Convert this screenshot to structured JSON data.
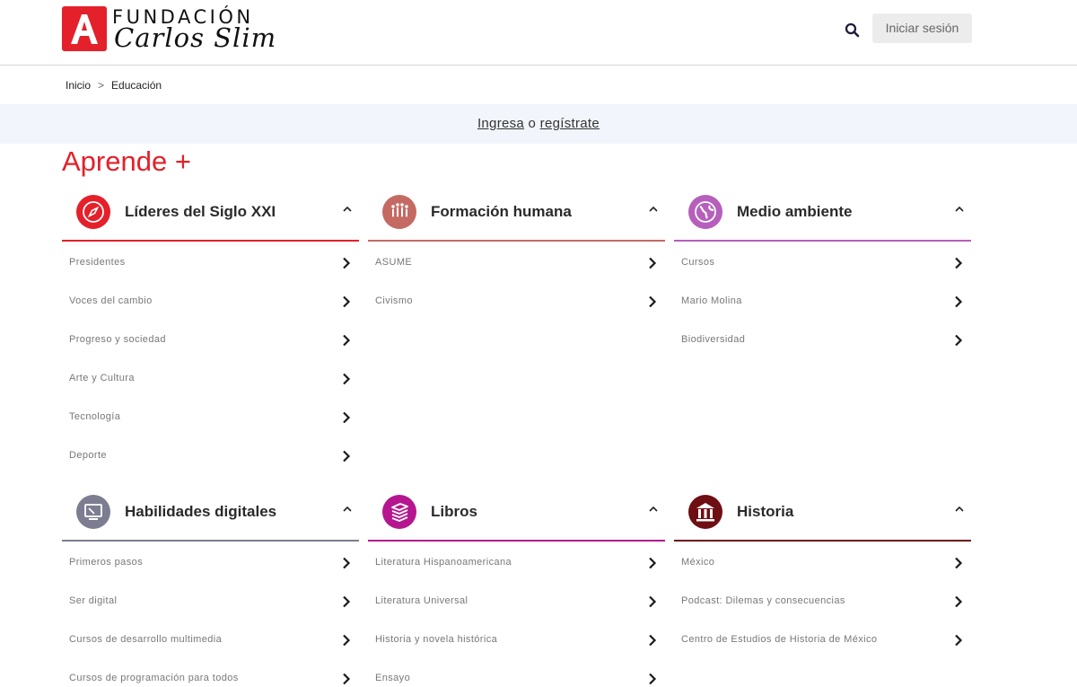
{
  "header": {
    "logo_letter": "A",
    "logo_line1": "FUNDACIÓN",
    "logo_line2": "Carlos Slim",
    "login_label": "Iniciar sesión",
    "search_icon": "search-icon"
  },
  "breadcrumb": {
    "home": "Inicio",
    "separator": ">",
    "current": "Educación"
  },
  "banner": {
    "login_link": "Ingresa",
    "connector": "o",
    "register_link": "regístrate"
  },
  "page_title": "Aprende +",
  "colors": {
    "brand_red": "#e4202a"
  },
  "sections": [
    {
      "title": "Líderes del Siglo XXI",
      "icon": "compass-icon",
      "color": "#e4202a",
      "items": [
        "Presidentes",
        "Voces del cambio",
        "Progreso y sociedad",
        "Arte y Cultura",
        "Tecnología",
        "Deporte"
      ]
    },
    {
      "title": "Formación humana",
      "icon": "people-icon",
      "color": "#c46a63",
      "items": [
        "ASUME",
        "Civismo"
      ]
    },
    {
      "title": "Medio ambiente",
      "icon": "globe-icon",
      "color": "#b65fbb",
      "items": [
        "Cursos",
        "Mario Molina",
        "Biodiversidad"
      ]
    },
    {
      "title": "Habilidades digitales",
      "icon": "monitor-icon",
      "color": "#7d7d92",
      "items": [
        "Primeros pasos",
        "Ser digital",
        "Cursos de desarrollo multimedia",
        "Cursos de programación para todos"
      ]
    },
    {
      "title": "Libros",
      "icon": "books-icon",
      "color": "#b5168f",
      "items": [
        "Literatura Hispanoamericana",
        "Literatura Universal",
        "Historia y novela histórica",
        "Ensayo"
      ]
    },
    {
      "title": "Historia",
      "icon": "columns-icon",
      "color": "#6e0f14",
      "items": [
        "México",
        "Podcast: Dilemas y consecuencias",
        "Centro de Estudios de Historia de México"
      ]
    }
  ]
}
